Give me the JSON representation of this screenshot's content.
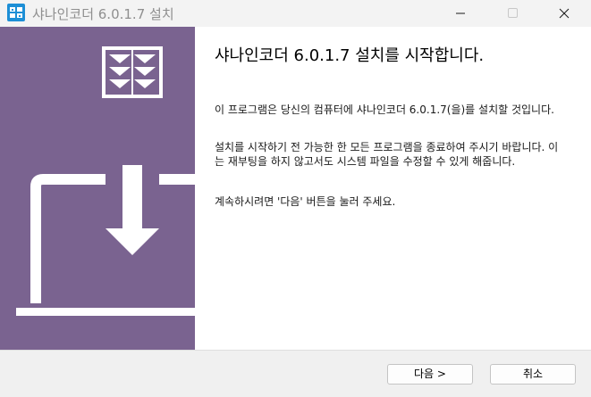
{
  "window": {
    "title": "샤나인코더 6.0.1.7 설치",
    "app_icon": "shanaencoder-app-icon",
    "controls": [
      "minimize-icon",
      "maximize-icon",
      "close-icon"
    ]
  },
  "banner": {
    "background_color": "#7a6390",
    "icons": [
      "logo-mark-icon",
      "laptop-download-icon"
    ]
  },
  "content": {
    "heading": "샤나인코더 6.0.1.7 설치를 시작합니다.",
    "paragraphs": [
      "이 프로그램은 당신의 컴퓨터에 샤나인코더 6.0.1.7(을)를 설치할 것입니다.",
      "설치를 시작하기 전 가능한 한 모든 프로그램을 종료하여 주시기 바랍니다. 이는 재부팅을 하지 않고서도 시스템 파일을 수정할 수 있게 해줍니다.",
      "계속하시려면 '다음' 버튼을 눌러 주세요."
    ]
  },
  "footer": {
    "next_label": "다음 >",
    "cancel_label": "취소"
  }
}
